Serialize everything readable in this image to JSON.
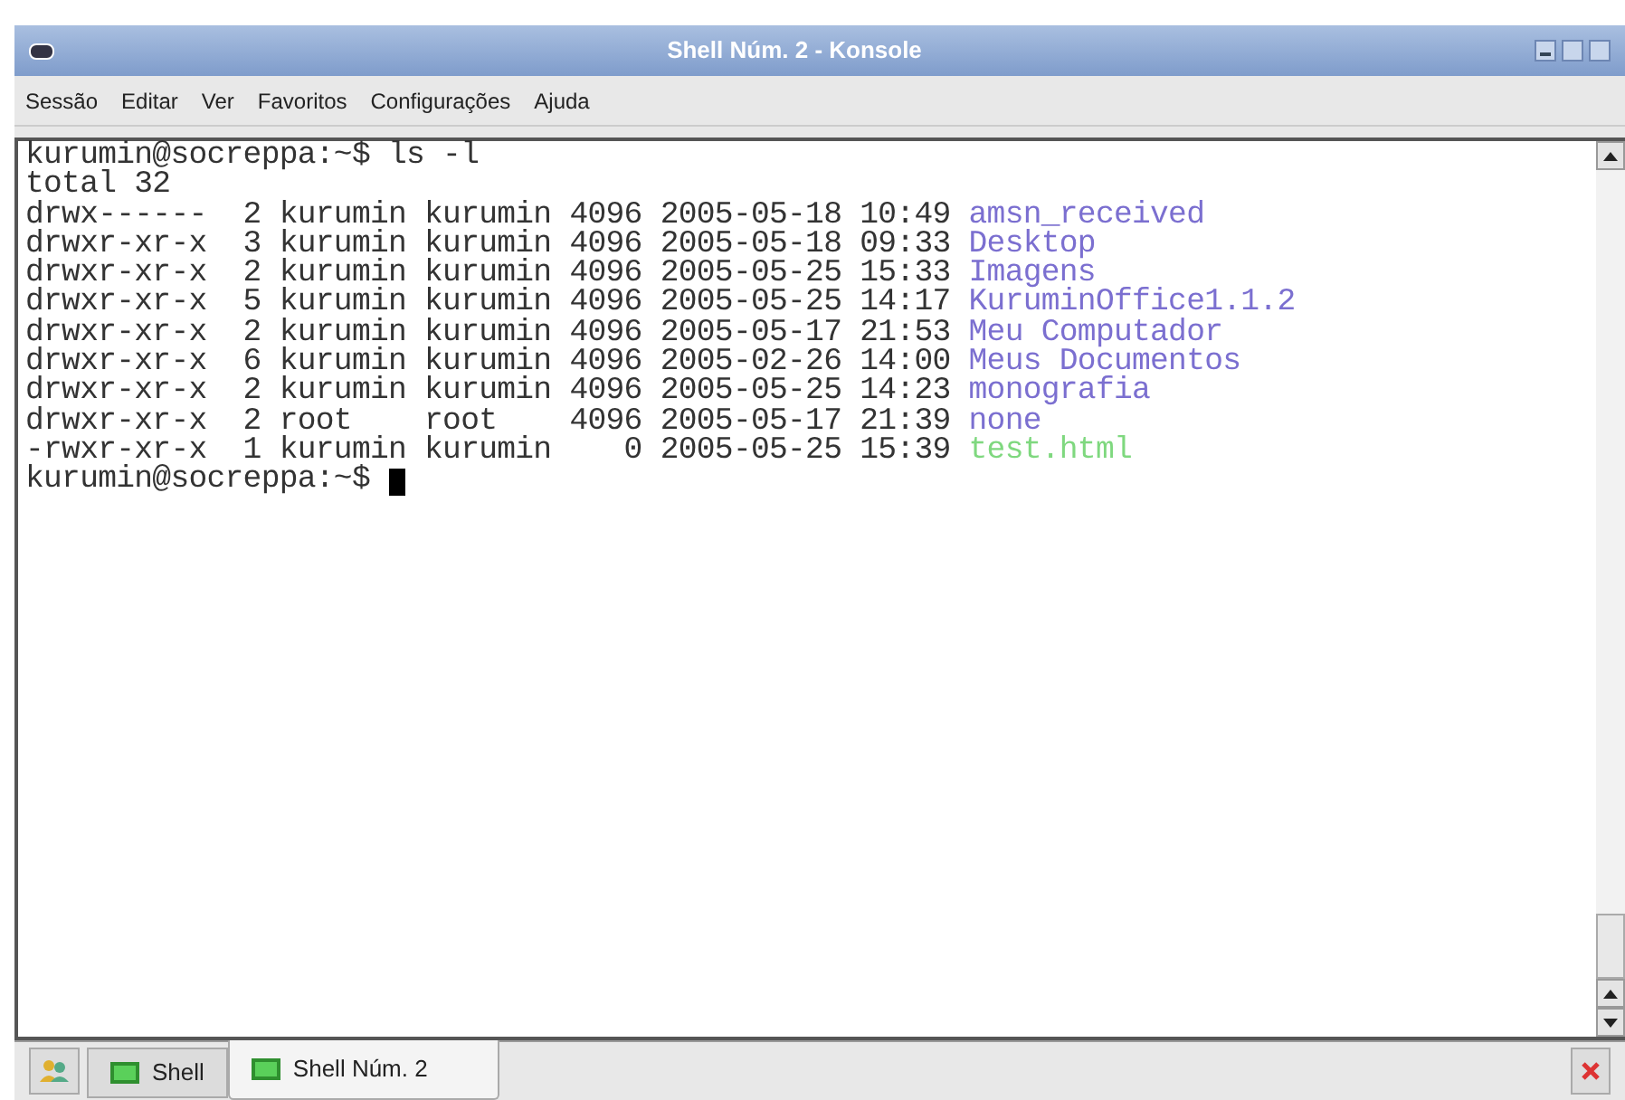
{
  "window": {
    "title": "Shell Núm. 2 - Konsole"
  },
  "menu": [
    "Sessão",
    "Editar",
    "Ver",
    "Favoritos",
    "Configurações",
    "Ajuda"
  ],
  "terminal": {
    "lines": [
      {
        "text": "kurumin@socreppa:~$ ls -l"
      },
      {
        "text": "total 32"
      },
      {
        "text": "drwx------  2 kurumin kurumin 4096 2005-05-18 10:49 ",
        "name": "amsn_received",
        "color": "#7b6fd0"
      },
      {
        "text": "drwxr-xr-x  3 kurumin kurumin 4096 2005-05-18 09:33 ",
        "name": "Desktop",
        "color": "#7b6fd0"
      },
      {
        "text": "drwxr-xr-x  2 kurumin kurumin 4096 2005-05-25 15:33 ",
        "name": "Imagens",
        "color": "#7b6fd0"
      },
      {
        "text": "drwxr-xr-x  5 kurumin kurumin 4096 2005-05-25 14:17 ",
        "name": "KuruminOffice1.1.2",
        "color": "#7b6fd0"
      },
      {
        "text": "drwxr-xr-x  2 kurumin kurumin 4096 2005-05-17 21:53 ",
        "name": "Meu Computador",
        "color": "#7b6fd0"
      },
      {
        "text": "drwxr-xr-x  6 kurumin kurumin 4096 2005-02-26 14:00 ",
        "name": "Meus Documentos",
        "color": "#7b6fd0"
      },
      {
        "text": "drwxr-xr-x  2 kurumin kurumin 4096 2005-05-25 14:23 ",
        "name": "monografia",
        "color": "#7b6fd0"
      },
      {
        "text": "drwxr-xr-x  2 root    root    4096 2005-05-17 21:39 ",
        "name": "none",
        "color": "#7b6fd0"
      },
      {
        "text": "-rwxr-xr-x  1 kurumin kurumin    0 2005-05-25 15:39 ",
        "name": "test.html",
        "color": "#7fd87f"
      }
    ],
    "prompt": "kurumin@socreppa:~$ "
  },
  "tabs": [
    {
      "label": "Shell",
      "selected": false
    },
    {
      "label": "Shell Núm. 2",
      "selected": true
    }
  ]
}
